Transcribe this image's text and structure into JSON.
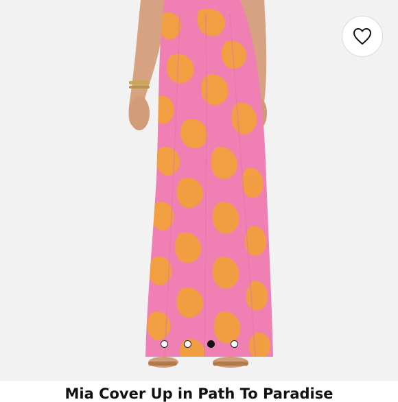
{
  "product": {
    "title": "Mia Cover Up in Path To Paradise",
    "image": {
      "description_icon": "product-photo",
      "colors": {
        "pink": "#f07fb4",
        "orange": "#f2a13a",
        "skin": "#d9a585",
        "background": "#f2f2f2"
      }
    }
  },
  "wishlist": {
    "icon": "heart-icon"
  },
  "carousel": {
    "total_slides": 4,
    "active_index": 2
  }
}
